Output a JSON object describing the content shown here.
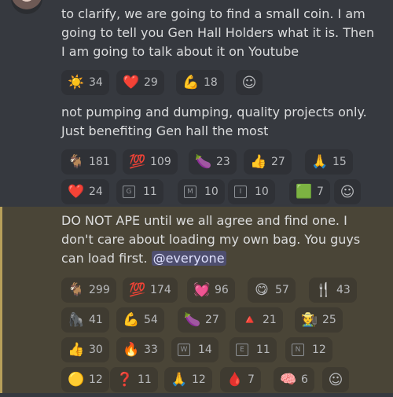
{
  "messages": [
    {
      "paragraphs": [
        "to clarify, we are going to find a small coin.  I am going to tell you Gen Hall Holders what it is.  Then I am going to talk about it on Youtube"
      ],
      "reactions": [
        [
          {
            "emoji": "☀️",
            "count": "34"
          },
          {
            "emoji": "❤️",
            "count": "29"
          },
          {
            "emoji": "💪",
            "count": "18"
          }
        ]
      ]
    },
    {
      "paragraphs": [
        "not pumping and dumping, quality projects only.  Just benefiting Gen hall the most"
      ],
      "reactions": [
        [
          {
            "emoji": "🐐",
            "count": "181"
          },
          {
            "emoji": "💯",
            "count": "109"
          },
          {
            "emoji": "🍆",
            "count": "23"
          },
          {
            "emoji": "👍",
            "count": "27"
          },
          {
            "emoji": "🙏",
            "count": "15"
          }
        ],
        [
          {
            "emoji": "❤️",
            "count": "24"
          },
          {
            "emoji": "G",
            "count": "11",
            "box": true
          },
          {
            "emoji": "M",
            "count": "10",
            "box": true
          },
          {
            "emoji": "I",
            "count": "10",
            "box": true
          },
          {
            "emoji": "🟩",
            "count": "7"
          }
        ]
      ]
    },
    {
      "text_main": "DO NOT APE until we all agree and find one.  I don't care about loading my own bag.  You guys can load first.",
      "mention": "@everyone",
      "reactions": [
        [
          {
            "emoji": "🐐",
            "count": "299"
          },
          {
            "emoji": "💯",
            "count": "174"
          },
          {
            "emoji": "💓",
            "count": "96"
          },
          {
            "emoji": "😋",
            "count": "57"
          },
          {
            "emoji": "🍴",
            "count": "43"
          }
        ],
        [
          {
            "emoji": "🦍",
            "count": "41"
          },
          {
            "emoji": "💪",
            "count": "54"
          },
          {
            "emoji": "🍆",
            "count": "27"
          },
          {
            "emoji": "🔺",
            "count": "21"
          },
          {
            "emoji": "🧑‍🌾",
            "count": "25"
          }
        ],
        [
          {
            "emoji": "👍",
            "count": "30"
          },
          {
            "emoji": "🔥",
            "count": "33"
          },
          {
            "emoji": "W",
            "count": "14",
            "box": true
          },
          {
            "emoji": "E",
            "count": "11",
            "box": true
          },
          {
            "emoji": "N",
            "count": "12",
            "box": true
          }
        ],
        [
          {
            "emoji": "🟡",
            "count": "12"
          },
          {
            "emoji": "❓",
            "count": "11"
          },
          {
            "emoji": "🙏",
            "count": "12"
          },
          {
            "emoji": "🩸",
            "count": "7"
          },
          {
            "emoji": "🧠",
            "count": "6"
          }
        ]
      ]
    }
  ],
  "icons": {
    "add_reaction": "add-reaction-icon"
  }
}
